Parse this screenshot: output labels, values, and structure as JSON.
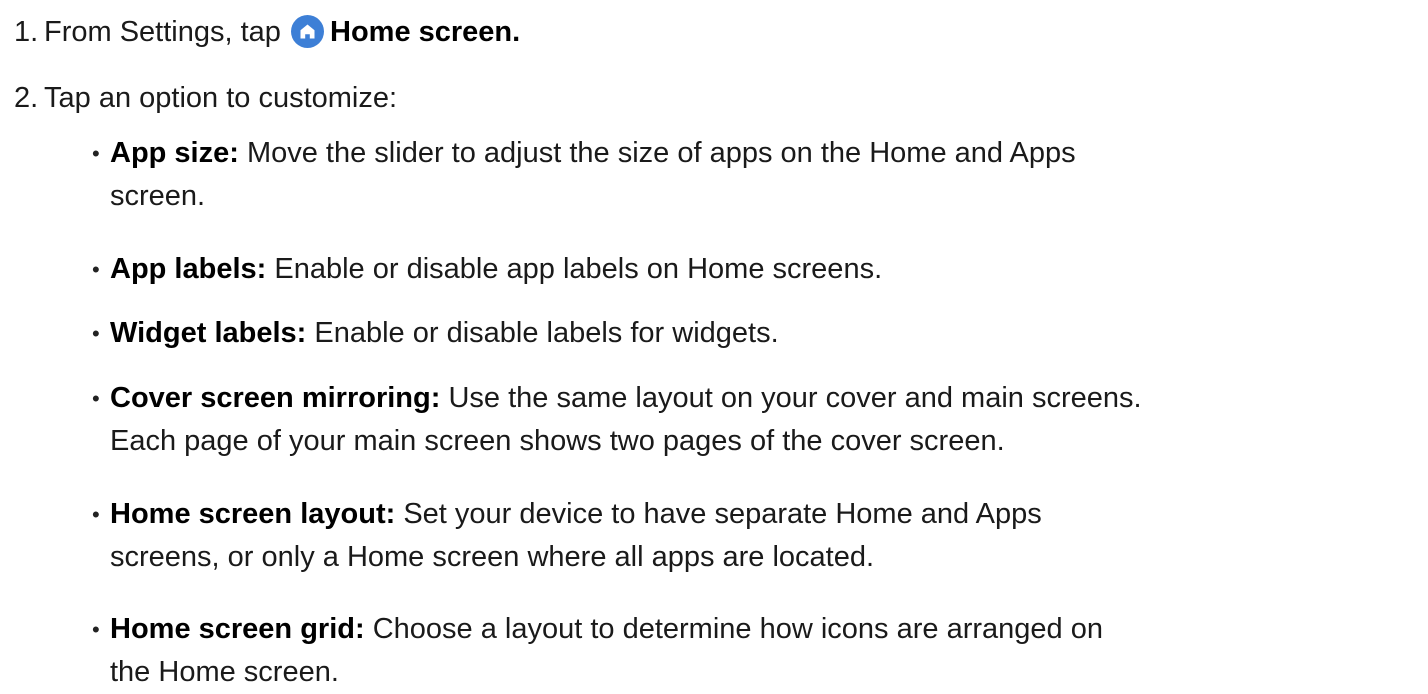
{
  "steps": [
    {
      "number": "1.",
      "text_before": "From Settings, tap",
      "icon": "home-icon",
      "bold_text": "Home screen."
    },
    {
      "number": "2.",
      "text": "Tap an option to customize:"
    }
  ],
  "options": [
    {
      "title": "App size:",
      "line1": " Move the slider to adjust the size of apps on the Home and Apps",
      "line2": "screen."
    },
    {
      "title": "App labels:",
      "line1": " Enable or disable app labels on Home screens."
    },
    {
      "title": "Widget labels:",
      "line1": " Enable or disable labels for widgets."
    },
    {
      "title": "Cover screen mirroring:",
      "line1": " Use the same layout on your cover and main screens.",
      "line2": "Each page of your main screen shows two pages of the cover screen."
    },
    {
      "title": "Home screen layout:",
      "line1": " Set your device to have separate Home and Apps",
      "line2": "screens, or only a Home screen where all apps are located."
    },
    {
      "title": "Home screen grid:",
      "line1": " Choose a layout to determine how icons are arranged on",
      "line2": "the Home screen."
    }
  ],
  "colors": {
    "icon_background": "#3d7fd6",
    "icon_foreground": "#ffffff"
  }
}
